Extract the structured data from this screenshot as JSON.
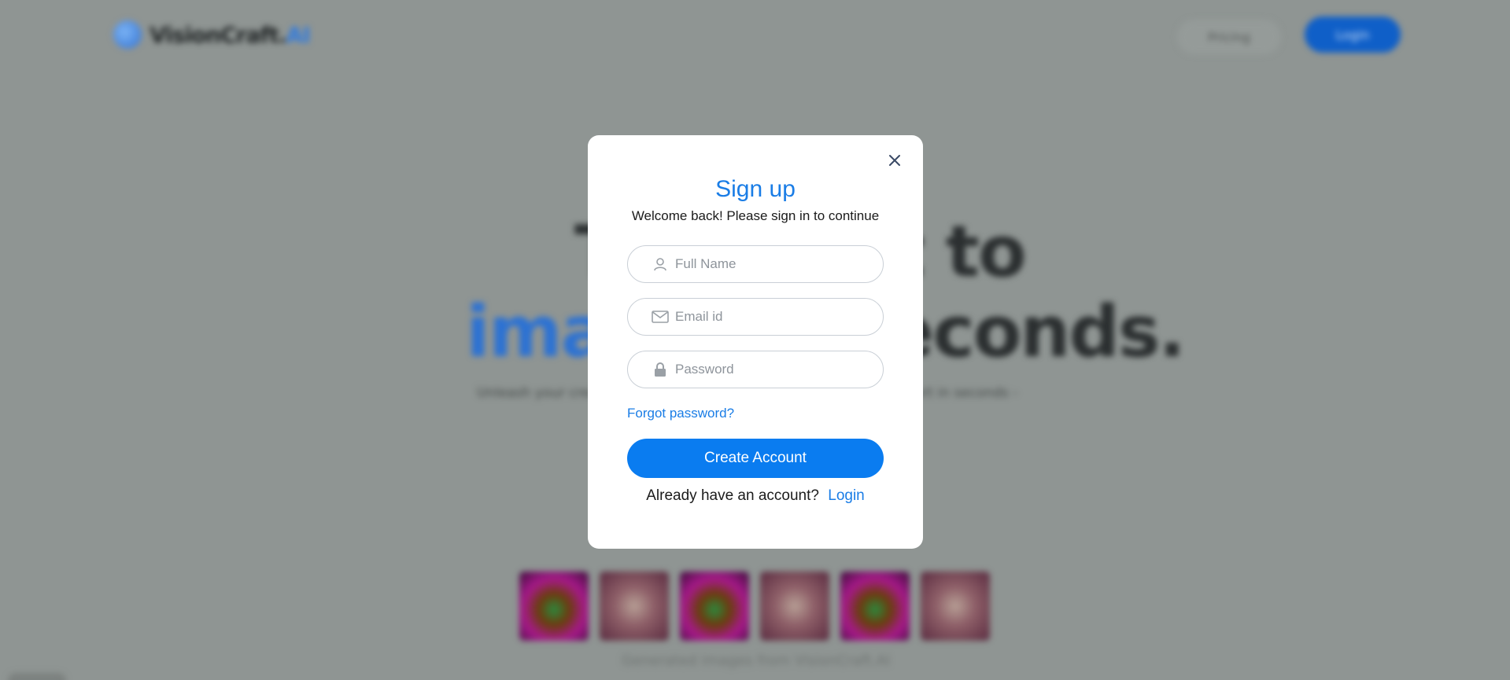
{
  "background": {
    "brand": {
      "name": "VisionCraft",
      "suffix": "AI"
    },
    "nav": {
      "pricing": "Pricing",
      "login": "Login"
    },
    "hero": {
      "line1": "Turn text to",
      "line2_blue": "image",
      "line2_rest": ", in seconds.",
      "subtitle": "Unleash your creativity with AI. Turn your imagination into visual art in seconds -"
    },
    "gallery_caption": "Generated images from VisionCraft.AI"
  },
  "modal": {
    "title": "Sign up",
    "subtitle": "Welcome back! Please sign in to continue",
    "full_name_placeholder": "Full Name",
    "email_placeholder": "Email id",
    "password_placeholder": "Password",
    "forgot": "Forgot password?",
    "submit": "Create Account",
    "switch_text": "Already have an account?",
    "switch_link": "Login"
  },
  "icons": {
    "close": "close-icon",
    "user": "user-icon",
    "mail": "mail-icon",
    "lock": "lock-icon"
  },
  "colors": {
    "accent": "#0a7cf0",
    "overlay": "#8f9593"
  }
}
